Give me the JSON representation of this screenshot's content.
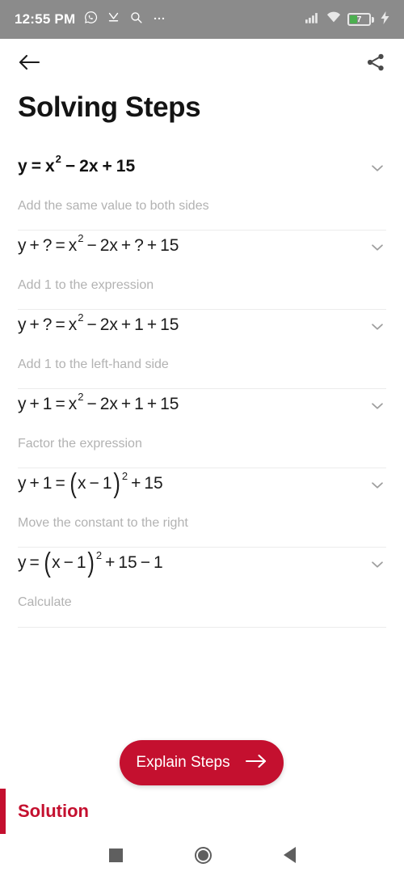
{
  "status_bar": {
    "time": "12:55 PM",
    "icons_left": [
      "whatsapp-icon",
      "download-complete-icon",
      "search-icon",
      "more-dots-icon"
    ],
    "icons_right": [
      "signal-bars-icon",
      "wifi-icon",
      "battery-icon",
      "charging-bolt-icon"
    ],
    "battery_level": "7",
    "battery_fill_color": "#4caf50",
    "background_color": "#8b8b8b"
  },
  "app_bar": {
    "back_icon": "arrow-left-icon",
    "share_icon": "share-icon"
  },
  "header": {
    "title": "Solving Steps"
  },
  "steps": [
    {
      "formula_text": "y = x^2 - 2x + 15",
      "hint": "Add the same value to both sides",
      "bold": true,
      "chevron": "chevron-down-icon"
    },
    {
      "formula_text": "y + ? = x^2 - 2x + ? + 15",
      "hint": "Add 1 to the expression",
      "bold": false,
      "chevron": "chevron-down-icon"
    },
    {
      "formula_text": "y + ? = x^2 - 2x + 1 + 15",
      "hint": "Add 1 to the left-hand side",
      "bold": false,
      "chevron": "chevron-down-icon"
    },
    {
      "formula_text": "y + 1 = x^2 - 2x + 1 + 15",
      "hint": "Factor the expression",
      "bold": false,
      "chevron": "chevron-down-icon"
    },
    {
      "formula_text": "y + 1 = (x - 1)^2 + 15",
      "hint": "Move the constant to the right",
      "bold": false,
      "chevron": "chevron-down-icon"
    },
    {
      "formula_text": "y = (x - 1)^2 + 15 - 1",
      "hint": "Calculate",
      "bold": false,
      "chevron": "chevron-down-icon"
    }
  ],
  "explain_button": {
    "label": "Explain Steps",
    "arrow_icon": "arrow-right-icon",
    "background_color": "#c4102f",
    "text_color": "#ffffff"
  },
  "solution": {
    "label": "Solution",
    "accent_color": "#c4102f"
  },
  "nav_bar": {
    "recents_icon": "square-recents-icon",
    "home_icon": "circle-home-icon",
    "back_icon": "triangle-back-icon"
  },
  "colors": {
    "hint_text": "#b2b2b2",
    "formula_text": "#1c1c1c",
    "divider": "#ececec",
    "page_background": "#ffffff"
  }
}
